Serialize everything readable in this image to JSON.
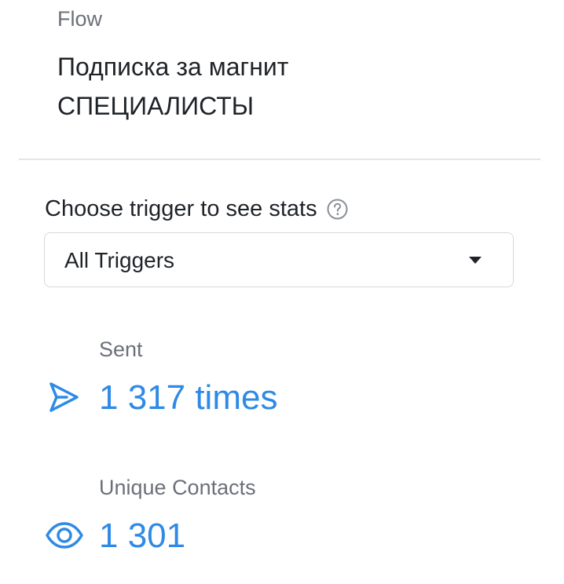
{
  "flow": {
    "label": "Flow",
    "name_line1": "Подписка за магнит",
    "name_line2": "СПЕЦИАЛИСТЫ"
  },
  "trigger": {
    "heading": "Choose trigger to see stats",
    "help_icon": "question-circle-icon",
    "selected": "All Triggers",
    "caret_icon": "caret-down-icon"
  },
  "stats": {
    "sent": {
      "label": "Sent",
      "value": "1 317 times",
      "icon": "send-icon"
    },
    "unique_contacts": {
      "label": "Unique Contacts",
      "value": "1 301",
      "icon": "eye-icon"
    }
  },
  "colors": {
    "accent": "#2e8ae6",
    "muted_text": "#6b7078",
    "primary_text": "#1f2328",
    "border": "#d6d9dd"
  }
}
